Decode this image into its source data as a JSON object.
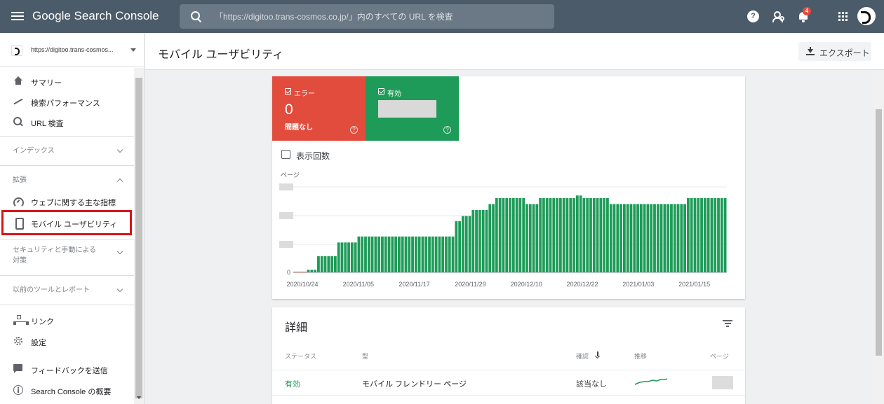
{
  "topbar": {
    "logo": "Google Search Console",
    "search_placeholder": "「https://digitoo.trans-cosmos.co.jp/」内のすべての URL を検査",
    "help_glyph": "?",
    "notification_count": "4",
    "icons": [
      "menu-icon",
      "search-icon",
      "help-icon",
      "user-settings-icon",
      "bell-icon",
      "apps-icon",
      "account-icon"
    ]
  },
  "sidebar": {
    "property": "https://digitoo.trans-cosmos...",
    "top_items": [
      {
        "label": "サマリー",
        "icon": "home-icon"
      },
      {
        "label": "検索パフォーマンス",
        "icon": "trending-icon"
      },
      {
        "label": "URL 検査",
        "icon": "search-icon"
      }
    ],
    "section_index": "インデックス",
    "section_enhancements": "拡張",
    "enh_items": [
      {
        "label": "ウェブに関する主な指標",
        "icon": "gauge-icon"
      },
      {
        "label": "モバイル ユーザビリティ",
        "icon": "phone-icon"
      }
    ],
    "section_security_line1": "セキュリティと手動による",
    "section_security_line2": "対策",
    "section_legacy": "以前のツールとレポート",
    "bottom_items": [
      {
        "label": "リンク",
        "icon": "sitemap-icon"
      },
      {
        "label": "設定",
        "icon": "gear-icon"
      },
      {
        "label": "フィードバックを送信",
        "icon": "feedback-icon"
      },
      {
        "label": "Search Console の概要",
        "icon": "info-icon"
      }
    ]
  },
  "header": {
    "title": "モバイル ユーザビリティ",
    "export_label": "エクスポート"
  },
  "tiles": {
    "error_label": "エラー",
    "error_value": "0",
    "error_sub": "問題なし",
    "valid_label": "有効",
    "help_glyph": "?"
  },
  "impressions_label": "表示回数",
  "chart_data": {
    "type": "bar",
    "ylabel": "ページ",
    "y_tick_labels_visible": [
      "0"
    ],
    "x_tick_labels": [
      "2020/10/24",
      "2020/11/05",
      "2020/11/17",
      "2020/11/29",
      "2020/12/10",
      "2020/12/22",
      "2021/01/03",
      "2021/01/15"
    ],
    "note_values": "y-axis values other than 0 are redacted; values are relative (0-100 scale)",
    "values": [
      0,
      0,
      0,
      0,
      3,
      3,
      3,
      19,
      19,
      19,
      19,
      19,
      19,
      35,
      35,
      35,
      35,
      35,
      35,
      42,
      42,
      42,
      42,
      42,
      42,
      42,
      42,
      42,
      42,
      42,
      42,
      42,
      42,
      42,
      42,
      42,
      42,
      42,
      42,
      42,
      42,
      42,
      42,
      42,
      42,
      42,
      42,
      42,
      60,
      60,
      66,
      66,
      66,
      73,
      73,
      73,
      73,
      73,
      80,
      80,
      87,
      87,
      87,
      87,
      87,
      87,
      87,
      87,
      87,
      80,
      80,
      80,
      80,
      87,
      87,
      87,
      87,
      87,
      87,
      87,
      87,
      87,
      87,
      87,
      90,
      90,
      87,
      87,
      87,
      87,
      87,
      87,
      87,
      87,
      80,
      80,
      80,
      80,
      80,
      80,
      80,
      80,
      80,
      80,
      80,
      80,
      80,
      80,
      80,
      80,
      80,
      80,
      80,
      80,
      80,
      80,
      80,
      87,
      87,
      87,
      87,
      87,
      87,
      87,
      87,
      87,
      87,
      87,
      87
    ],
    "bar_color": "#1e9b58",
    "grid": true
  },
  "details": {
    "title": "詳細",
    "columns": [
      "ステータス",
      "型",
      "確認",
      "推移",
      "ページ"
    ],
    "rows": [
      {
        "status": "有効",
        "type": "モバイル フレンドリー ページ",
        "validation": "該当なし"
      }
    ],
    "status_color": "#1e9b58"
  }
}
